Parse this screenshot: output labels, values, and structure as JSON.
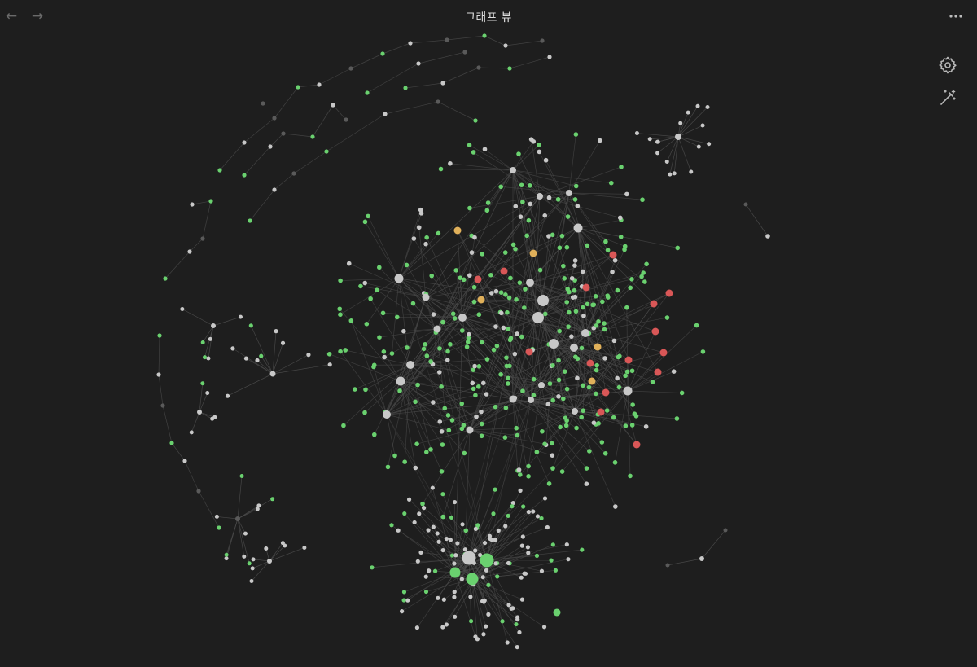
{
  "header": {
    "title": "그래프 뷰",
    "back_icon": "arrow-left-icon",
    "forward_icon": "arrow-right-icon",
    "more_icon": "more-options-icon"
  },
  "controls": {
    "settings_icon": "gear-icon",
    "magic_icon": "magic-wand-icon"
  },
  "colors": {
    "background": "#1e1e1e",
    "edge": "#4a4a4a",
    "node_note": "#c8c8c8",
    "node_green": "#6ad16f",
    "node_red": "#d95757",
    "node_orange": "#e0b05a",
    "node_dim": "#5a5a5a"
  }
}
